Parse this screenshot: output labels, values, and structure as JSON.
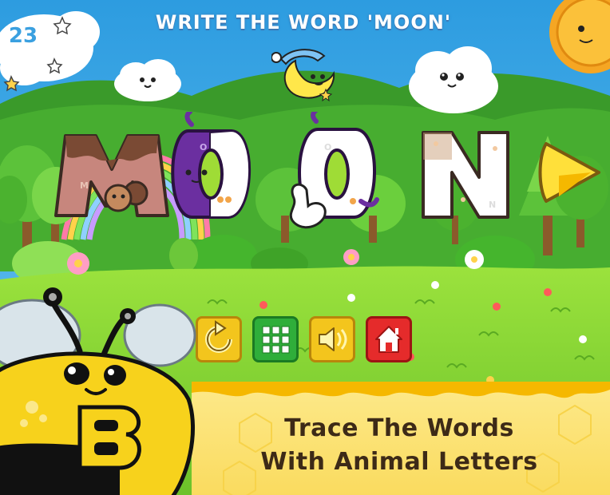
{
  "header": {
    "instruction": "WRITE THE WORD 'MOON'",
    "counter": "23"
  },
  "word": {
    "letters": [
      "M",
      "O",
      "O",
      "N"
    ]
  },
  "controls": {
    "buttons": [
      {
        "id": "replay",
        "icon": "replay-arrow-icon"
      },
      {
        "id": "menu",
        "icon": "grid-icon"
      },
      {
        "id": "sound",
        "icon": "speaker-icon"
      },
      {
        "id": "home",
        "icon": "house-icon"
      }
    ]
  },
  "promo": {
    "line1": "Trace The Words",
    "line2": "With Animal Letters"
  },
  "colors": {
    "sky": "#34a7e6",
    "hill": "#3fa32c",
    "grass": "#88d832",
    "honey": "#fbe37a",
    "bee_yellow": "#f7d21c"
  }
}
